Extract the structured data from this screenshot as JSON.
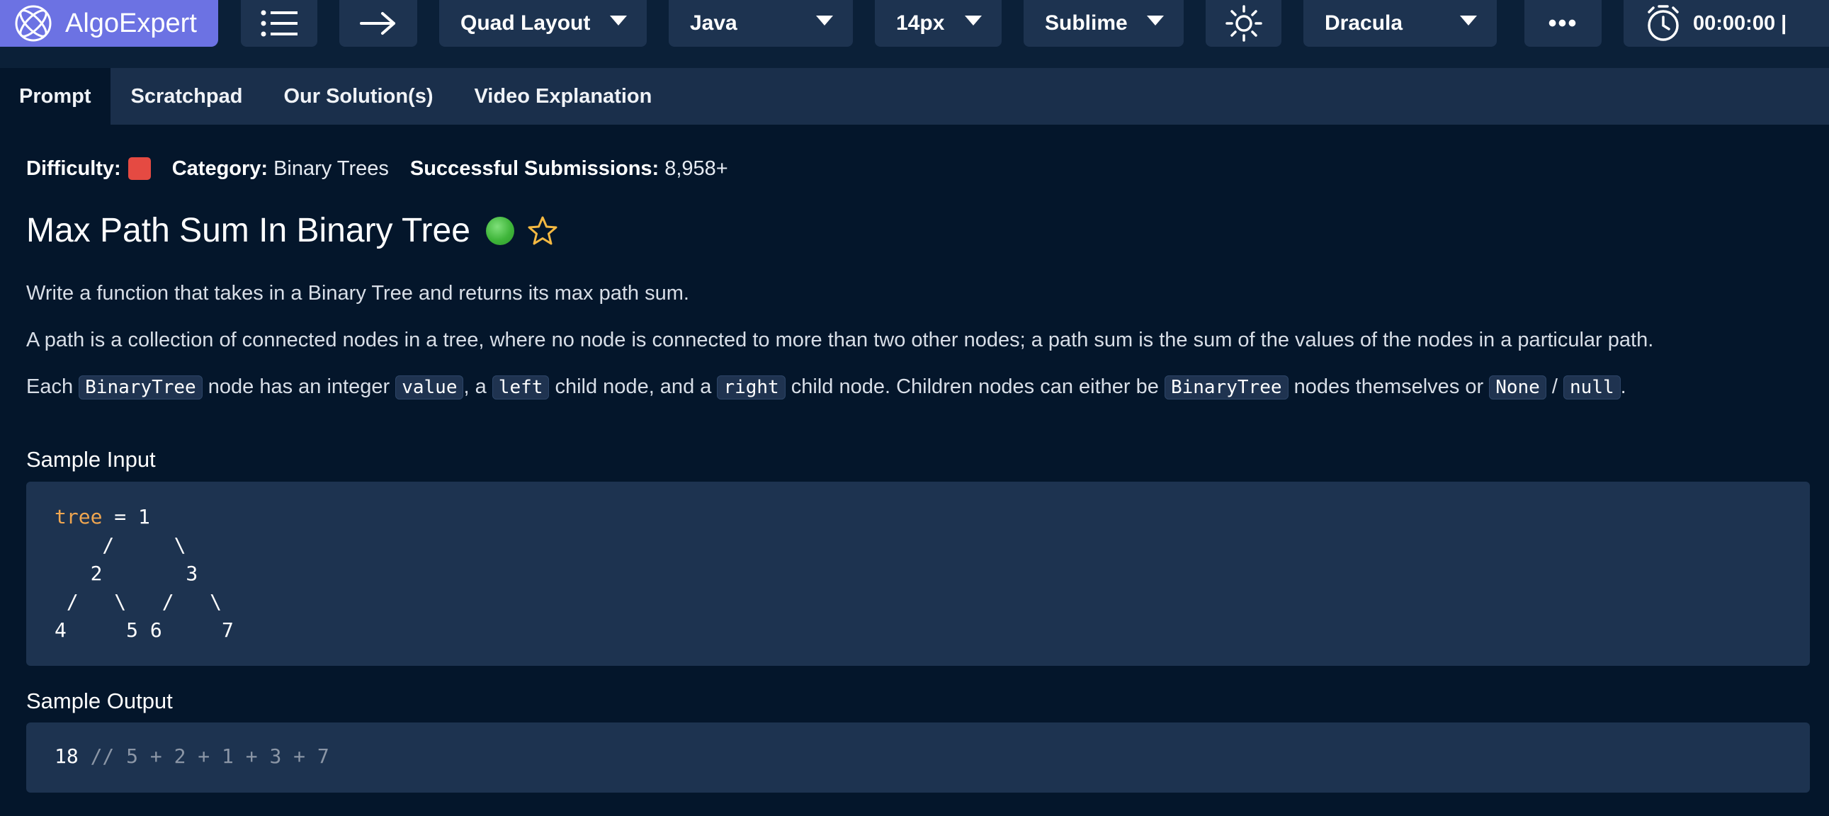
{
  "toolbar": {
    "brand": "AlgoExpert",
    "layout": "Quad Layout",
    "language": "Java",
    "font_size": "14px",
    "keymap": "Sublime",
    "theme": "Dracula",
    "more": "•••",
    "timer": "00:00:00 |"
  },
  "tabs": [
    "Prompt",
    "Scratchpad",
    "Our Solution(s)",
    "Video Explanation"
  ],
  "meta": {
    "difficulty_label": "Difficulty:",
    "difficulty_color": "#e54a42",
    "category_label": "Category:",
    "category_value": "Binary Trees",
    "submissions_label": "Successful Submissions:",
    "submissions_value": "8,958+"
  },
  "problem": {
    "title": "Max Path Sum In Binary Tree",
    "status_color": "#3fb53a",
    "p1": "Write a function that takes in a Binary Tree and returns its max path sum.",
    "p2": "A path is a collection of connected nodes in a tree, where no node is connected to more than two other nodes; a path sum is the sum of the values of the nodes in a particular path.",
    "p3": {
      "t1": "Each ",
      "c1": "BinaryTree",
      "t2": " node has an integer ",
      "c2": "value",
      "t3": ", a ",
      "c3": "left",
      "t4": " child node, and a ",
      "c4": "right",
      "t5": " child node. Children nodes can either be ",
      "c5": "BinaryTree",
      "t6": " nodes themselves or ",
      "c6": "None",
      "t7": " / ",
      "c7": "null",
      "t8": "."
    }
  },
  "sample_input": {
    "heading": "Sample Input",
    "var": "tree",
    "first_line_rest": " = 1",
    "lines": [
      "    /     \\",
      "   2       3",
      " /   \\   /   \\",
      "4     5 6     7"
    ]
  },
  "sample_output": {
    "heading": "Sample Output",
    "value": "18",
    "comment": " // 5 + 2 + 1 + 3 + 7"
  }
}
